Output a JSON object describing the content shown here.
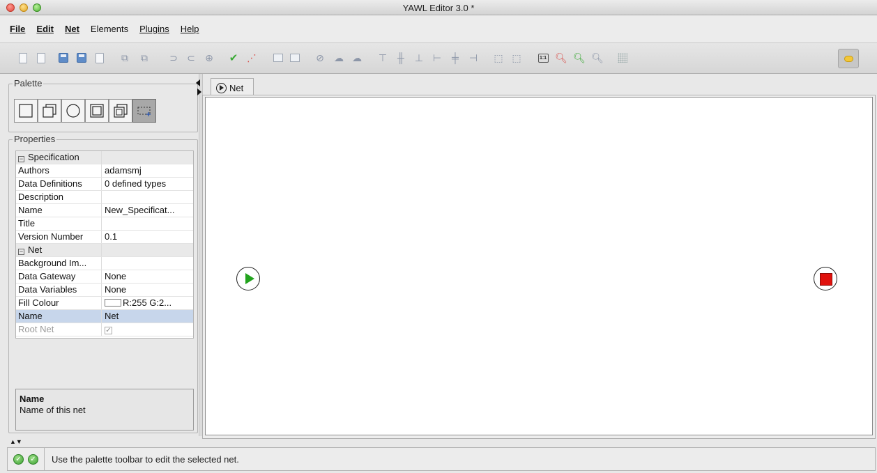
{
  "window": {
    "title": "YAWL Editor 3.0 *"
  },
  "menu": [
    {
      "label": "File",
      "bold": true
    },
    {
      "label": "Edit",
      "bold": true
    },
    {
      "label": "Net",
      "bold": true
    },
    {
      "label": "Elements",
      "bold": false
    },
    {
      "label": "Plugins",
      "bold": false
    },
    {
      "label": "Help",
      "bold": false
    }
  ],
  "toolbar": {
    "icons": [
      "new-spec-icon",
      "open-spec-icon",
      "save-icon",
      "save-as-icon",
      "close-spec-icon",
      "import-icon",
      "export-icon",
      "undo-icon",
      "redo-icon",
      "delete-icon",
      "validate-icon",
      "analyse-icon",
      "add-net-icon",
      "remove-net-icon",
      "cancel-icon",
      "add-comment-icon",
      "remove-comment-icon",
      "align-top-icon",
      "align-middle-icon",
      "align-bottom-icon",
      "align-left-icon",
      "align-center-icon",
      "align-right-icon",
      "increase-size-icon",
      "decrease-size-icon",
      "actual-size-icon",
      "zoom-out-icon",
      "zoom-in-icon",
      "zoom-fit-icon",
      "grid-icon",
      "notes-icon"
    ]
  },
  "palette": {
    "title": "Palette",
    "tools": [
      {
        "name": "atomic-task-icon"
      },
      {
        "name": "multiple-atomic-task-icon"
      },
      {
        "name": "condition-icon"
      },
      {
        "name": "composite-task-icon"
      },
      {
        "name": "multiple-composite-task-icon"
      },
      {
        "name": "marquee-select-icon",
        "selected": true
      }
    ]
  },
  "properties": {
    "title": "Properties",
    "rows": [
      {
        "type": "section",
        "name": "Specification"
      },
      {
        "name": "Authors",
        "value": "adamsmj"
      },
      {
        "name": "Data Definitions",
        "value": "0 defined types"
      },
      {
        "name": "Description",
        "value": ""
      },
      {
        "name": "Name",
        "value": "New_Specificat..."
      },
      {
        "name": "Title",
        "value": ""
      },
      {
        "name": "Version Number",
        "value": "0.1"
      },
      {
        "type": "section",
        "name": "Net"
      },
      {
        "name": "Background Im...",
        "value": ""
      },
      {
        "name": "Data Gateway",
        "value": "None"
      },
      {
        "name": "Data Variables",
        "value": "None"
      },
      {
        "name": "Fill Colour",
        "value": "R:255 G:2...",
        "swatch": "#ffffff"
      },
      {
        "name": "Name",
        "value": "Net",
        "selected": true
      },
      {
        "name": "Root Net",
        "value": "",
        "checkbox": true,
        "disabled": true
      }
    ],
    "description": {
      "title": "Name",
      "text": "Name of this net"
    }
  },
  "tabs": [
    {
      "label": "Net"
    }
  ],
  "status": {
    "message": "Use the palette toolbar to edit the selected net."
  },
  "colors": {
    "start": "#22a31d",
    "end": "#e0110d",
    "selected_row": "#c7d6eb"
  }
}
